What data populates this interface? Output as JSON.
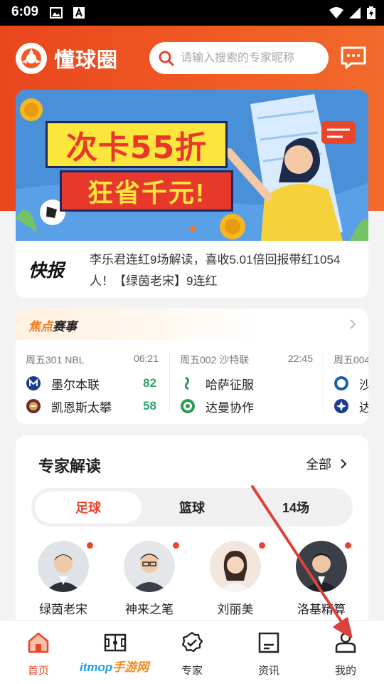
{
  "status_bar": {
    "time": "6:09"
  },
  "header": {
    "app_name": "懂球圈",
    "search_placeholder": "请输入搜索的专家昵称"
  },
  "banner": {
    "line1": "次卡55折",
    "line2": "狂省千元!"
  },
  "news": {
    "badge": "快报",
    "text": "李乐君连红9场解读，喜收5.01倍回报带红1054人！【绿茵老宋】9连红"
  },
  "matches": {
    "title_highlight": "焦点",
    "title_rest": "赛事",
    "items": [
      {
        "league": "周五301 NBL",
        "time": "06:21",
        "home": "墨尔本联",
        "away": "凯恩斯太攀",
        "home_score": "82",
        "away_score": "58"
      },
      {
        "league": "周五002 沙特联",
        "time": "22:45",
        "home": "哈萨征服",
        "away": "达曼协作",
        "home_score": "",
        "away_score": ""
      },
      {
        "league": "周五004",
        "time": "",
        "home": "沙",
        "away": "达",
        "home_score": "",
        "away_score": ""
      }
    ]
  },
  "experts": {
    "title": "专家解读",
    "all_label": "全部",
    "tabs": [
      "足球",
      "篮球",
      "14场"
    ],
    "active_tab": 0,
    "people": [
      {
        "name": "绿茵老宋"
      },
      {
        "name": "神来之笔"
      },
      {
        "name": "刘丽美"
      },
      {
        "name": "洛基精算"
      }
    ]
  },
  "tabbar": {
    "items": [
      {
        "label": "首页",
        "active": true
      },
      {
        "label": "",
        "active": false
      },
      {
        "label": "专家",
        "active": false
      },
      {
        "label": "资讯",
        "active": false
      },
      {
        "label": "我的",
        "active": false
      }
    ]
  },
  "watermark": {
    "part1": "itmop",
    "part2": "手游网"
  },
  "colors": {
    "brand": "#f05c24",
    "active": "#e8452a",
    "win": "#2ea56a",
    "annotation_arrow": "#d9433b"
  }
}
